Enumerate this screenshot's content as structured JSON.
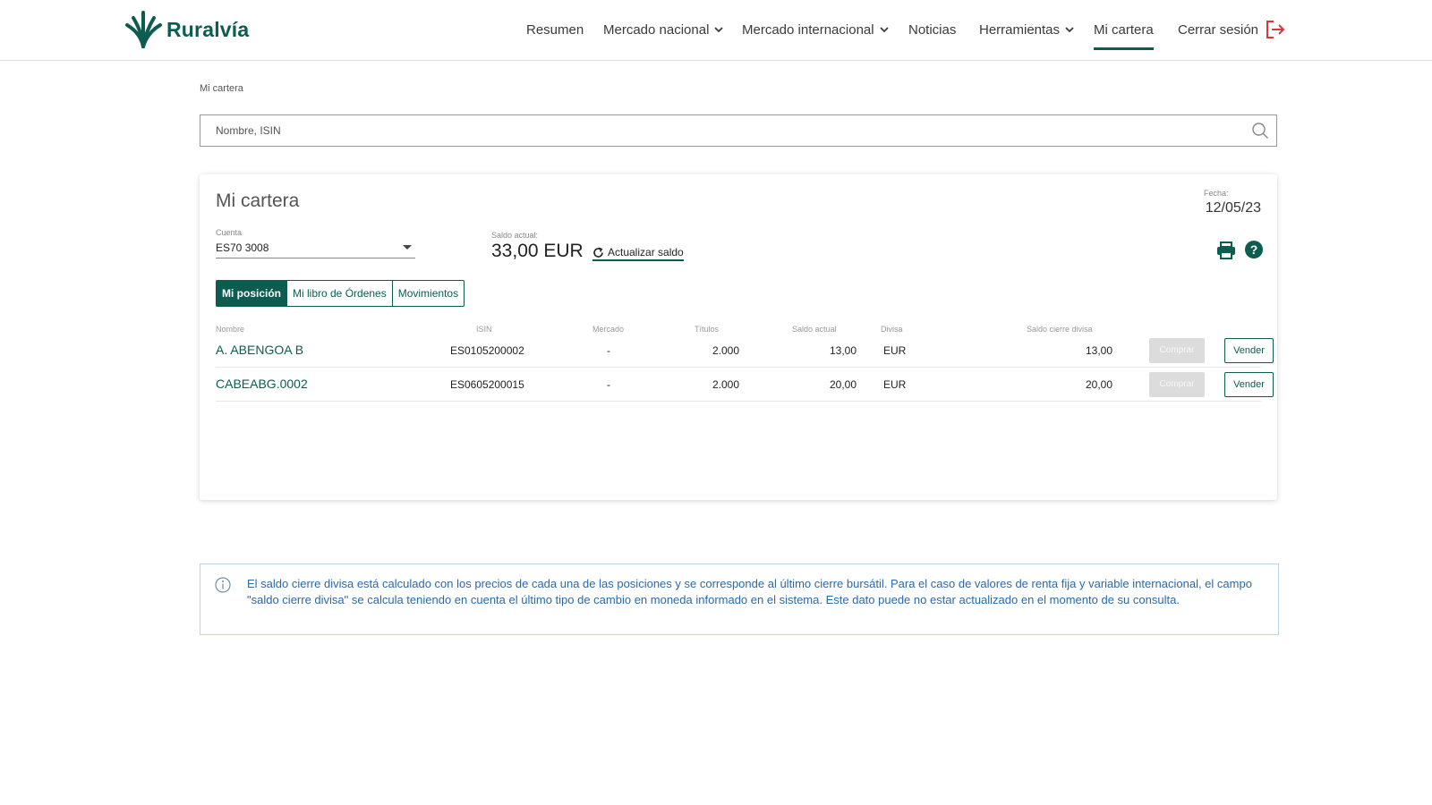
{
  "app": {
    "logo_text": "Ruralvía",
    "brand_color": "#0c5c50"
  },
  "nav": {
    "items": [
      {
        "label": "Resumen"
      },
      {
        "label": "Mercado nacional"
      },
      {
        "label": "Mercado internacional"
      },
      {
        "label": "Noticias"
      },
      {
        "label": "Herramientas"
      },
      {
        "label": "Mi cartera"
      }
    ],
    "logout_label": "Cerrar sesión",
    "active": "Mi cartera"
  },
  "breadcrumb": "Mi cartera",
  "search": {
    "placeholder": "Nombre, ISIN",
    "value": ""
  },
  "card": {
    "title": "Mi cartera",
    "fecha_label": "Fecha:",
    "fecha_value": "12/05/23",
    "cuenta_label": "Cuenta",
    "cuenta_value": "ES70 3008",
    "saldo_label": "Saldo actual:",
    "saldo_value": "33,00 EUR",
    "actualizar_label": "Actualizar saldo",
    "help_symbol": "?",
    "tabs": [
      {
        "label": "Mi posición",
        "active": true
      },
      {
        "label": "Mi libro de Órdenes",
        "active": false
      },
      {
        "label": "Movimientos",
        "active": false
      }
    ]
  },
  "table": {
    "headers": {
      "nombre": "Nombre",
      "isin": "ISIN",
      "mercado": "Mercado",
      "titulos": "Títulos",
      "saldo_actual": "Saldo actual",
      "divisa": "Divisa",
      "saldo_cierre": "Saldo cierre divisa"
    },
    "rows": [
      {
        "nombre": "A. ABENGOA B",
        "isin": "ES0105200002",
        "mercado": "-",
        "titulos": "2.000",
        "saldo_actual": "13,00",
        "divisa": "EUR",
        "saldo_cierre": "13,00",
        "comprar": "Comprar",
        "vender": "Vender"
      },
      {
        "nombre": "CABEABG.0002",
        "isin": "ES0605200015",
        "mercado": "-",
        "titulos": "2.000",
        "saldo_actual": "20,00",
        "divisa": "EUR",
        "saldo_cierre": "20,00",
        "comprar": "Comprar",
        "vender": "Vender"
      }
    ]
  },
  "info": {
    "text": "El saldo cierre divisa está calculado con los precios de cada una de las posiciones y se corresponde al último cierre bursátil. Para el caso de valores de renta fija y variable internacional, el campo \"saldo cierre divisa\" se calcula teniendo en cuenta el último tipo de cambio en moneda informado en el sistema. Este dato puede no estar actualizado en el momento de su consulta."
  }
}
